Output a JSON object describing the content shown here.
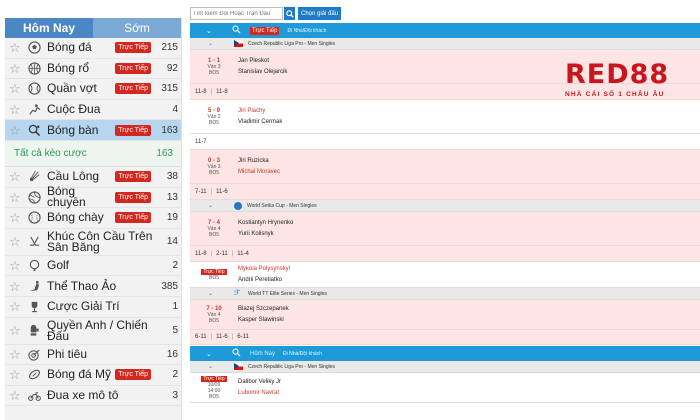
{
  "sidebar": {
    "tabs": {
      "today": "Hôm Nay",
      "early": "Sớm"
    },
    "items": [
      {
        "label": "Bóng đá",
        "live": "Trực Tiếp",
        "count": "215",
        "icon": "soccer-ball-icon"
      },
      {
        "label": "Bóng rổ",
        "live": "Trực Tiếp",
        "count": "92",
        "icon": "basketball-icon"
      },
      {
        "label": "Quần vợt",
        "live": "Trực Tiếp",
        "count": "315",
        "icon": "tennis-ball-icon"
      },
      {
        "label": "Cuộc Đua",
        "live": "",
        "count": "4",
        "icon": "racing-icon"
      },
      {
        "label": "Bóng bàn",
        "live": "Trực Tiếp",
        "count": "163",
        "icon": "table-tennis-icon"
      }
    ],
    "all_bets": {
      "label": "Tất cả kèo cược",
      "count": "163"
    },
    "items2": [
      {
        "label": "Cầu Lông",
        "live": "Trực Tiếp",
        "count": "38",
        "icon": "badminton-icon"
      },
      {
        "label": "Bóng chuyền",
        "live": "Trực Tiếp",
        "count": "13",
        "icon": "volleyball-icon"
      },
      {
        "label": "Bóng chày",
        "live": "Trực Tiếp",
        "count": "19",
        "icon": "baseball-icon"
      },
      {
        "label": "Khúc Côn Cầu Trên Sân Băng",
        "live": "",
        "count": "14",
        "icon": "ice-hockey-icon"
      },
      {
        "label": "Golf",
        "live": "",
        "count": "2",
        "icon": "golf-icon"
      },
      {
        "label": "Thể Thao Ảo",
        "live": "",
        "count": "385",
        "icon": "virtual-sports-icon"
      },
      {
        "label": "Cược Giải Trí",
        "live": "",
        "count": "1",
        "icon": "entertainment-icon"
      },
      {
        "label": "Quyền Anh / Chiến Đấu",
        "live": "",
        "count": "5",
        "icon": "boxing-icon"
      },
      {
        "label": "Phi tiêu",
        "live": "",
        "count": "16",
        "icon": "darts-icon"
      },
      {
        "label": "Bóng đá Mỹ",
        "live": "Trực Tiếp",
        "count": "2",
        "icon": "american-football-icon"
      },
      {
        "label": "Đua xe mô tô",
        "live": "",
        "count": "3",
        "icon": "motorbike-icon"
      }
    ]
  },
  "search": {
    "placeholder": "Tìm kiếm Đội Hoặc Trận Đấu",
    "choose_league": "Chọn giải đấu"
  },
  "main": {
    "live_header": {
      "live": "Trực Tiếp",
      "sub": "Đi Nhà/Đội khách"
    },
    "today_header": {
      "today": "Hôm Nay",
      "sub": "Đi Nhà/Đội khách"
    },
    "leagues": {
      "czech": "Czech Republic Liga Pro - Men Singles",
      "setka": "World Setka Cup - Men Singles",
      "wtt": "World TT Elite Series - Men Singles",
      "czech2": "Czech Republic Liga Pro - Men Singles"
    },
    "matches": [
      {
        "score": "1 - 1",
        "period": "Ván 3",
        "bo": "BO5",
        "home": "Jan Pleskot",
        "away": "Stanislav Olejarcik",
        "sets": [
          "11-8",
          "11-8"
        ]
      },
      {
        "score": "5 - 9",
        "period": "Ván 2",
        "bo": "BO5",
        "home": "Jiri Plachy",
        "away": "Vladimir Cermak",
        "sets": [
          "11-7"
        ]
      },
      {
        "score": "0 - 3",
        "period": "Ván 3",
        "bo": "BO5",
        "home": "Jiri Ruzicka",
        "away": "Michal Moravec",
        "sets": [
          "7-11",
          "11-6"
        ]
      },
      {
        "score": "7 - 4",
        "period": "Ván 4",
        "bo": "BO5",
        "home": "Kostiantyn Hrynenko",
        "away": "Yurii Kolisnyk",
        "sets": [
          "11-8",
          "2-11",
          "11-4"
        ]
      },
      {
        "live": "Trực Tiếp",
        "bo": "BO5",
        "home": "Mykola Polysynskyi",
        "away": "Andrii Peretiatko"
      },
      {
        "score": "7 - 10",
        "period": "Ván 4",
        "bo": "BO5",
        "home": "Blazej Szczepanek",
        "away": "Kasper Slawinski",
        "sets": [
          "6-11",
          "11-6",
          "6-11"
        ]
      },
      {
        "live": "Trực Tiếp",
        "date": "10/09",
        "time": "14:00",
        "bo": "BO5",
        "home": "Dalibor Veliky Jr",
        "away": "Lubomir Navrat"
      }
    ]
  },
  "logo": {
    "brand": "RED88",
    "tagline": "NHÀ CÁI SỐ 1 CHÂU ÂU"
  },
  "colors": {
    "accent": "#1f9ad8",
    "live": "#d3281f",
    "brand": "#c9161c"
  }
}
